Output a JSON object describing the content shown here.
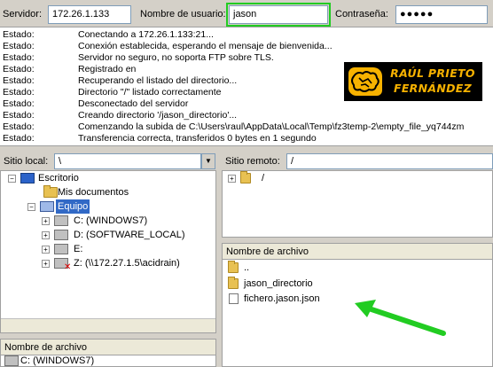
{
  "quickconnect": {
    "host_label": "Servidor:",
    "host_value": "172.26.1.133",
    "user_label": "Nombre de usuario:",
    "user_value": "jason",
    "pass_label": "Contraseña:",
    "pass_value": "●●●●●"
  },
  "log": {
    "rows": [
      {
        "k": "Estado:",
        "v": "Conectando a 172.26.1.133:21..."
      },
      {
        "k": "Estado:",
        "v": "Conexión establecida, esperando el mensaje de bienvenida..."
      },
      {
        "k": "Estado:",
        "v": "Servidor no seguro, no soporta FTP sobre TLS."
      },
      {
        "k": "Estado:",
        "v": "Registrado en"
      },
      {
        "k": "Estado:",
        "v": "Recuperando el listado del directorio..."
      },
      {
        "k": "Estado:",
        "v": "Directorio \"/\" listado correctamente"
      },
      {
        "k": "Estado:",
        "v": "Desconectado del servidor"
      },
      {
        "k": "Estado:",
        "v": "Creando directorio '/jason_directorio'..."
      },
      {
        "k": "Estado:",
        "v": "Comenzando la subida de C:\\Users\\raul\\AppData\\Local\\Temp\\fz3temp-2\\empty_file_yq744zm"
      },
      {
        "k": "Estado:",
        "v": "Transferencia correcta, transferidos 0 bytes en 1 segundo"
      }
    ],
    "brand_line1": "RAÚL PRIETO",
    "brand_line2": "FERNÁNDEZ"
  },
  "local": {
    "path_label": "Sitio local:",
    "path_value": "\\",
    "tree": [
      {
        "label": "Escritorio"
      },
      {
        "label": "Mis documentos"
      },
      {
        "label": "Equipo"
      },
      {
        "label": "C: (WINDOWS7)"
      },
      {
        "label": "D: (SOFTWARE_LOCAL)"
      },
      {
        "label": "E:"
      },
      {
        "label": "Z: (\\\\172.27.1.5\\acidrain)"
      }
    ],
    "list_header": "Nombre de archivo",
    "list_first": "C: (WINDOWS7)"
  },
  "remote": {
    "path_label": "Sitio remoto:",
    "path_value": "/",
    "tree_root": "/",
    "list_header": "Nombre de archivo",
    "files": [
      {
        "name": ".."
      },
      {
        "name": "jason_directorio"
      },
      {
        "name": "fichero.jason.json"
      }
    ]
  },
  "colors": {
    "highlight_outline": "#22cc22",
    "arrow": "#22cc22",
    "brand_yellow": "#f7b200"
  }
}
